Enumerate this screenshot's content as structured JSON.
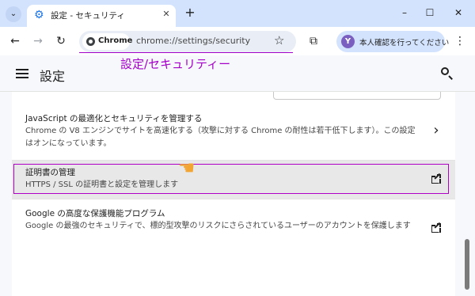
{
  "tab": {
    "title": "設定 - セキュリティ",
    "icon": "gear-icon",
    "close_glyph": "✕",
    "new_tab_glyph": "+"
  },
  "window": {
    "menu_glyph": "⌄",
    "minimize_glyph": "–",
    "maximize_glyph": "☐",
    "close_glyph": "✕"
  },
  "toolbar": {
    "back_glyph": "←",
    "forward_glyph": "→",
    "reload_glyph": "↻",
    "chip_label": "Chrome",
    "url": "chrome://settings/security",
    "bookmark_glyph": "☆",
    "extensions_glyph": "⧉",
    "profile_initial": "Y",
    "profile_label": "本人確認を行ってください",
    "menu_glyph": "⋮"
  },
  "annotation": {
    "caption": "設定/セキュリティー",
    "color": "#a400c8"
  },
  "settings": {
    "title": "設定",
    "rows": [
      {
        "title": "JavaScript の最適化とセキュリティを管理する",
        "description": "Chrome の V8 エンジンでサイトを高速化する（攻撃に対する Chrome の耐性は若干低下します）。この設定はオンになっています。",
        "action": "chevron-right-icon",
        "action_glyph": "›"
      },
      {
        "title": "証明書の管理",
        "description": "HTTPS / SSL の証明書と設定を管理します",
        "action": "open-external-icon"
      },
      {
        "title": "Google の高度な保護機能プログラム",
        "description": "Google の最強のセキュリティで、標的型攻撃のリスクにさらされているユーザーのアカウントを保護します",
        "action": "open-external-icon"
      }
    ]
  },
  "colors": {
    "tabstrip": "#d3e3fd",
    "page_bg": "#f6f8fc",
    "highlight_border": "#b000c8",
    "hand": "#f2a533"
  }
}
